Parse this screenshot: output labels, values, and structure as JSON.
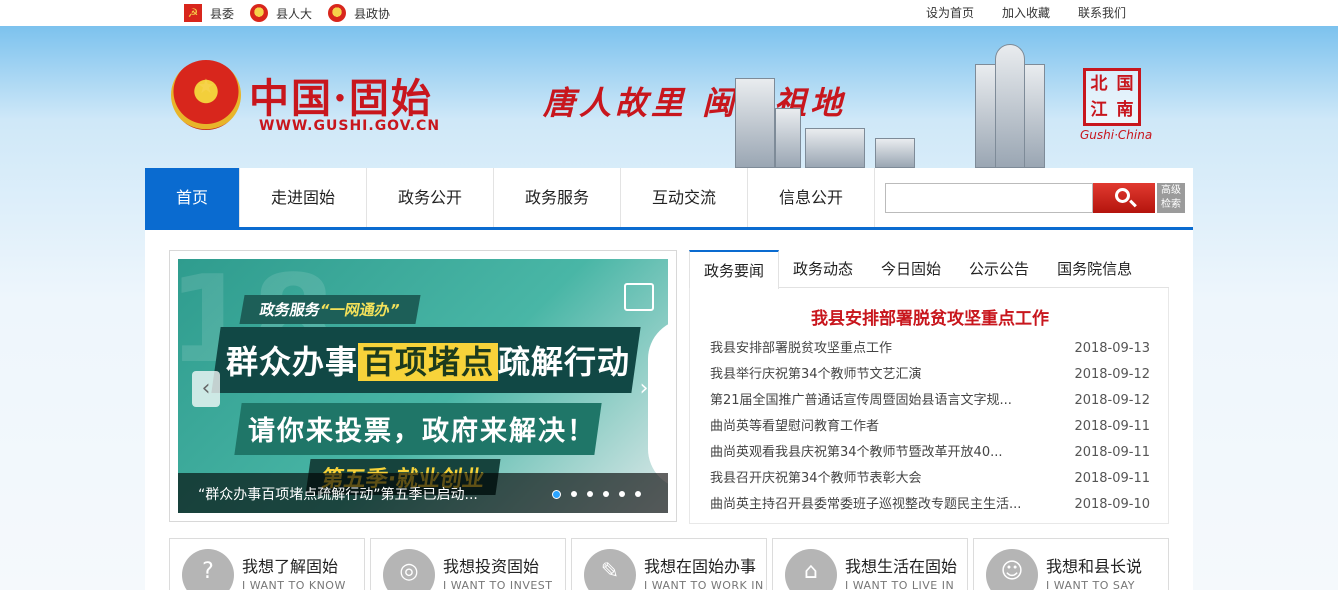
{
  "topbar": {
    "left_links": [
      "县委",
      "县人大",
      "县政协"
    ],
    "right_links": [
      "设为首页",
      "加入收藏",
      "联系我们"
    ]
  },
  "banner": {
    "site_name": "中国·固始",
    "site_url": "WWW.GUSHI.GOV.CN",
    "slogan": "唐人故里 闽台祖地",
    "seal_chars": [
      "北",
      "国",
      "江",
      "南"
    ],
    "seal_caption": "Gushi·China"
  },
  "nav": {
    "items": [
      "首页",
      "走进固始",
      "政务公开",
      "政务服务",
      "互动交流",
      "信息公开"
    ],
    "search_placeholder": "",
    "advanced_search": "高级检索"
  },
  "slider": {
    "tag_prefix": "政务服务",
    "tag_quote": "“一网通办”",
    "title_pre": "群众办事",
    "title_highlight": "百项堵点",
    "title_post": "疏解行动",
    "subtitle": "请你来投票，政府来解决！",
    "season": "第五季·就业创业",
    "caption": "“群众办事百项堵点疏解行动”第五季已启动...",
    "total_slides": 6,
    "active_slide": 1
  },
  "news": {
    "tabs": [
      "政务要闻",
      "政务动态",
      "今日固始",
      "公示公告",
      "国务院信息"
    ],
    "headline": "我县安排部署脱贫攻坚重点工作",
    "items": [
      {
        "title": "我县安排部署脱贫攻坚重点工作",
        "date": "2018-09-13"
      },
      {
        "title": "我县举行庆祝第34个教师节文艺汇演",
        "date": "2018-09-12"
      },
      {
        "title": "第21届全国推广普通话宣传周暨固始县语言文字规...",
        "date": "2018-09-12"
      },
      {
        "title": "曲尚英等看望慰问教育工作者",
        "date": "2018-09-11"
      },
      {
        "title": "曲尚英观看我县庆祝第34个教师节暨改革开放40...",
        "date": "2018-09-11"
      },
      {
        "title": "我县召开庆祝第34个教师节表彰大会",
        "date": "2018-09-11"
      },
      {
        "title": "曲尚英主持召开县委常委班子巡视整改专题民主生活...",
        "date": "2018-09-10"
      }
    ]
  },
  "cards": [
    {
      "title": "我想了解固始",
      "subtitle": "I WANT TO KNOW",
      "icon": "document-question-icon"
    },
    {
      "title": "我想投资固始",
      "subtitle": "I WANT TO INVEST",
      "icon": "coins-icon"
    },
    {
      "title": "我想在固始办事",
      "subtitle": "I WANT TO WORK IN",
      "icon": "edit-form-icon"
    },
    {
      "title": "我想生活在固始",
      "subtitle": "I WANT TO LIVE IN",
      "icon": "house-icon"
    },
    {
      "title": "我想和县长说",
      "subtitle": "I WANT TO SAY",
      "icon": "person-chat-icon"
    }
  ],
  "colors": {
    "brand_red": "#c8161d",
    "nav_blue": "#0a6bd0",
    "dot_active": "#2aa4ff"
  }
}
